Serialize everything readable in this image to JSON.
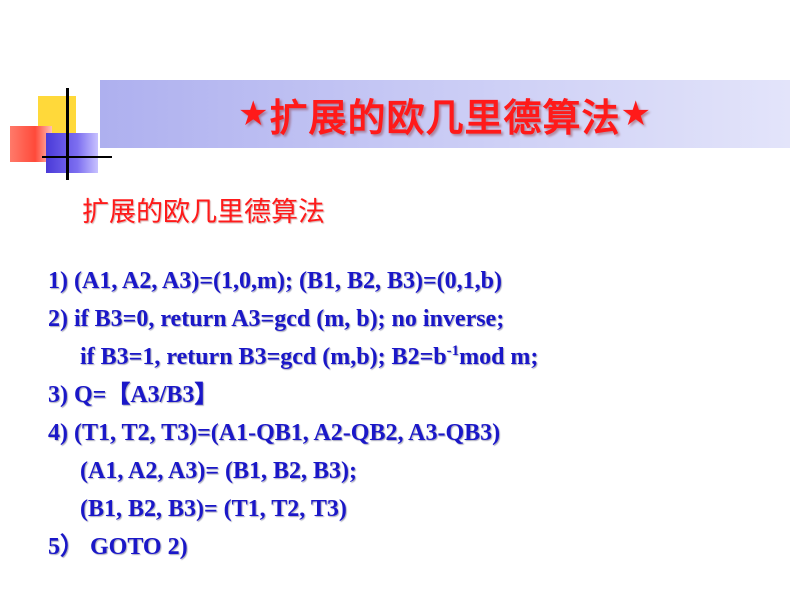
{
  "slide": {
    "title_star": "★",
    "title": "扩展的欧几里德算法",
    "subtitle": "扩展的欧几里德算法",
    "steps": {
      "l1": "1) (A1, A2, A3)=(1,0,m); (B1, B2, B3)=(0,1,b)",
      "l2": "2) if B3=0, return A3=gcd (m, b); no inverse;",
      "l3a": "if B3=1, return B3=gcd (m,b); B2=b",
      "l3sup": "-1",
      "l3b": "mod m;",
      "l4": "3) Q=【A3/B3】",
      "l5": "4) (T1, T2, T3)=(A1-QB1, A2-QB2, A3-QB3)",
      "l6": "(A1, A2, A3)= (B1, B2, B3);",
      "l7": "(B1, B2, B3)= (T1, T2, T3)",
      "l8": "5） GOTO 2)"
    }
  },
  "colors": {
    "title": "#ff1a1a",
    "body": "#1a17c8",
    "band": "#cfd1f6"
  }
}
